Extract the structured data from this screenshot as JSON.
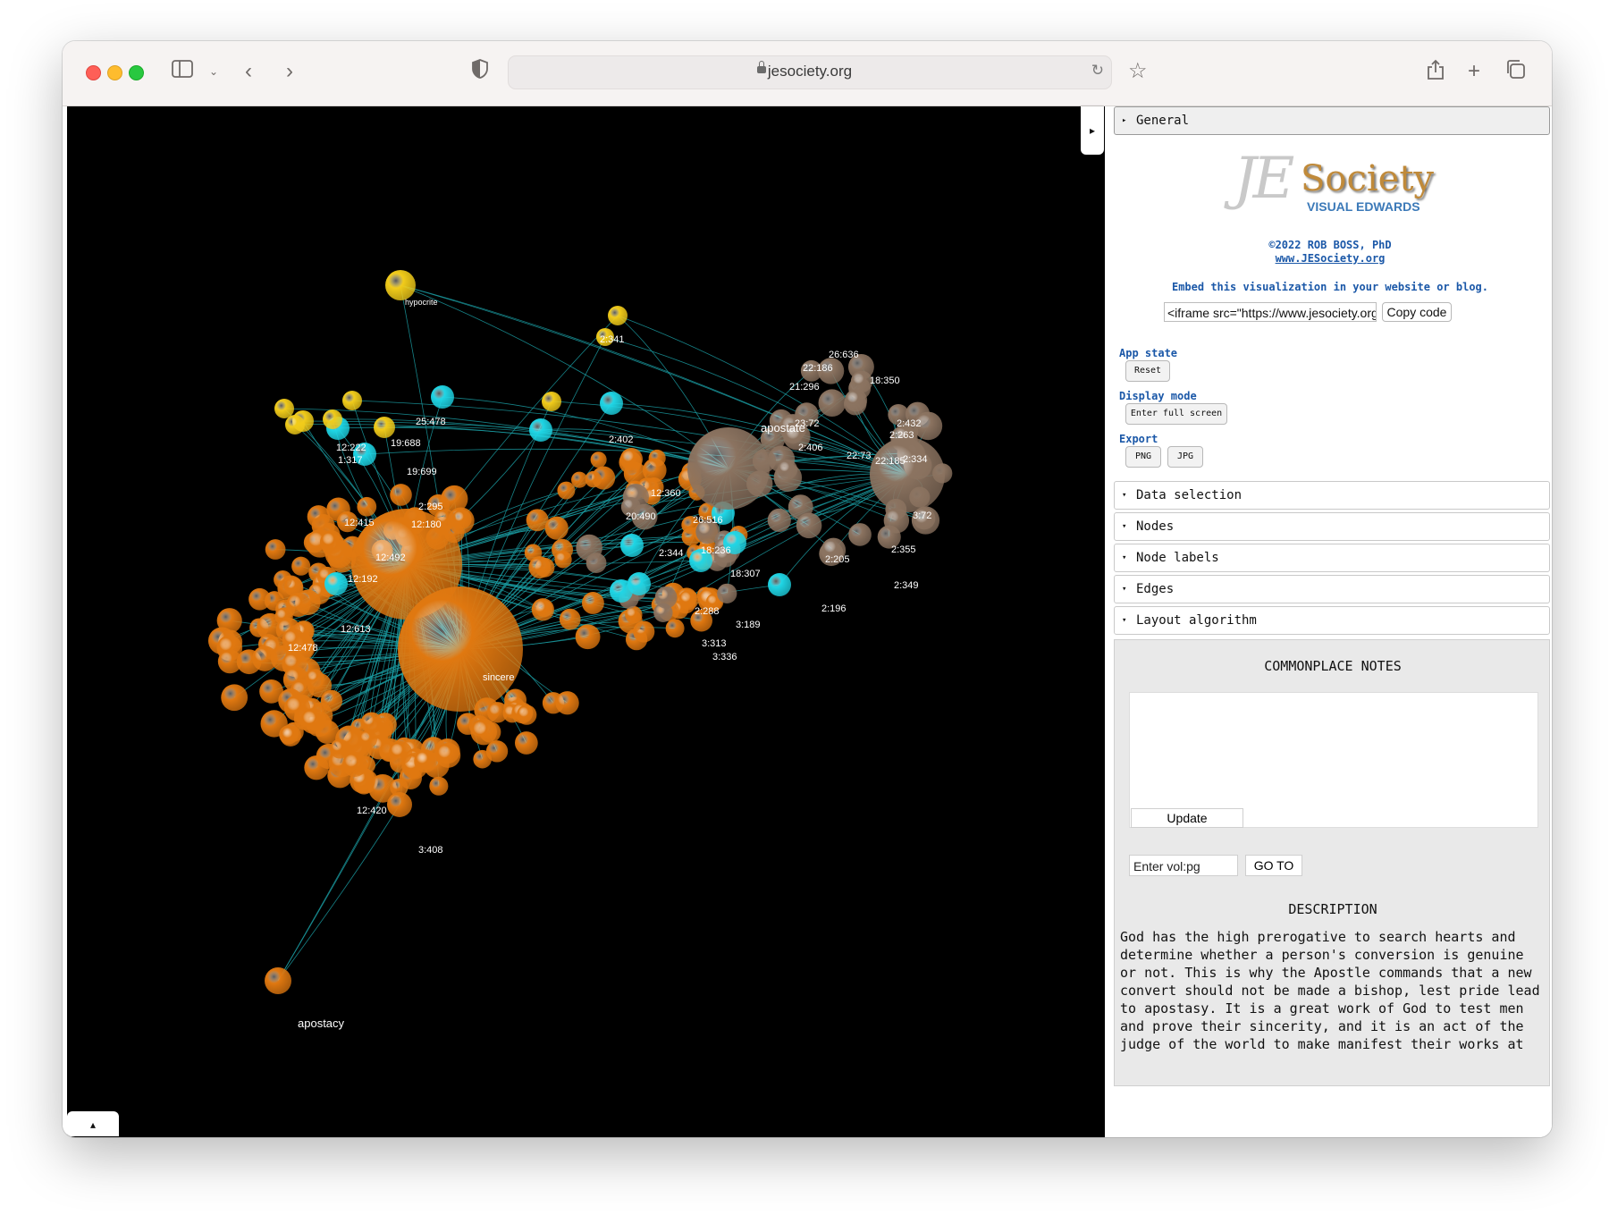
{
  "browser": {
    "url": "jesociety.org"
  },
  "graph": {
    "labels": [
      "hypocrite",
      "apostate",
      "apostacy",
      "sincere",
      "25:478",
      "19:688",
      "19:699",
      "2:402",
      "12:492",
      "12:192",
      "12:613",
      "12:415",
      "2:295",
      "12:180",
      "12:360",
      "26:516",
      "18:236",
      "18:307",
      "2:288",
      "3:313",
      "3:336",
      "3:189",
      "12:420",
      "3:408",
      "26:636",
      "22:186",
      "21:296",
      "23:72",
      "2:406",
      "22:73",
      "22:185",
      "2:432",
      "2:263",
      "2:334",
      "3:72",
      "2:355",
      "2:349",
      "2:205",
      "2:196",
      "18:350",
      "2:344",
      "20:490",
      "12:478",
      "2:341",
      "1:317",
      "12:222"
    ]
  },
  "side": {
    "general_label": "General",
    "logo_je": "JE",
    "logo_society": "Society",
    "logo_sub": "VISUAL EDWARDS",
    "credit_line1": "©2022 ROB BOSS, PhD",
    "credit_line2": "www.JESociety.org",
    "embed_label": "Embed this visualization in your website or blog.",
    "embed_value": "<iframe src=\"https://www.jesociety.org/i",
    "copy_label": "Copy code",
    "app_state_label": "App state",
    "reset_label": "Reset",
    "display_mode_label": "Display mode",
    "fullscreen_label": "Enter full screen",
    "export_label": "Export",
    "png_label": "PNG",
    "jpg_label": "JPG",
    "sections": [
      "Data selection",
      "Nodes",
      "Node labels",
      "Edges",
      "Layout algorithm"
    ],
    "notes_title": "COMMONPLACE NOTES",
    "update_label": "Update",
    "vol_placeholder": "Enter vol:pg",
    "goto_label": "GO TO",
    "desc_title": "DESCRIPTION",
    "desc_text": "God has the high prerogative to search hearts and determine whether a person's conversion is genuine or not. This is why the Apostle commands that a new convert should not be made a bishop, lest pride lead to apostasy. It is a great work of God to test men and prove their sincerity, and it is an act of the judge of the world to make manifest their works at"
  },
  "colors": {
    "orange": "#e07810",
    "brown": "#8b7360",
    "cyan": "#1fd6e6",
    "yellow": "#f2cc1a",
    "edge": "#1a9aa0"
  }
}
